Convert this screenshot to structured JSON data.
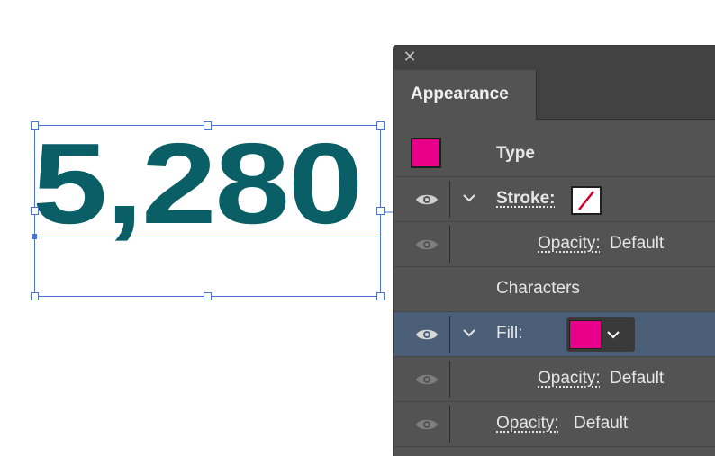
{
  "artwork": {
    "text": "5,280",
    "text_color": "#0a5e66",
    "selection_color": "#4a72d6"
  },
  "panel": {
    "close_icon": "✕",
    "tab_label": "Appearance",
    "rows": {
      "type_label": "Type",
      "stroke_label": "Stroke:",
      "stroke_opacity_label": "Opacity:",
      "stroke_opacity_value": "Default",
      "characters_label": "Characters",
      "fill_label": "Fill:",
      "fill_opacity_label": "Opacity:",
      "fill_opacity_value": "Default",
      "opacity_label": "Opacity:",
      "opacity_value": "Default"
    },
    "colors": {
      "fill": "#e8008b",
      "selected_row": "#4b6078",
      "panel_bg": "#535353"
    }
  }
}
